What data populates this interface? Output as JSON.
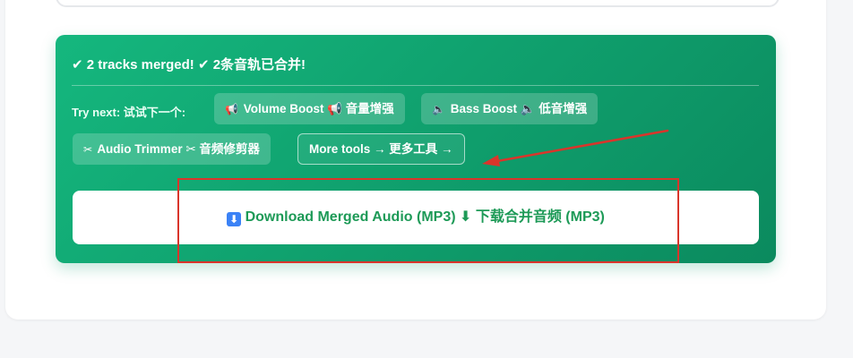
{
  "result": {
    "title": "✔ 2 tracks merged! ✔ 2条音轨已合并!",
    "try_next_label": "Try next: 试试下一个:",
    "tools": [
      {
        "icon": "megaphone-icon",
        "glyph": "📢",
        "label": "Volume Boost 📢 音量增强"
      },
      {
        "icon": "speaker-icon",
        "glyph": "🔈",
        "label": "Bass Boost 🔈 低音增强"
      },
      {
        "icon": "scissors-icon",
        "glyph": "✂",
        "label": "Audio Trimmer ✂ 音频修剪器"
      }
    ],
    "more_tools_label": "More tools → 更多工具 →",
    "download": {
      "glyph": "⬇",
      "label": "Download Merged Audio (MP3) ⬇ 下载合并音频 (MP3)"
    }
  },
  "colors": {
    "panel_green": "#12a873",
    "download_text": "#1d9a57",
    "annotation_red": "#d9352b"
  }
}
